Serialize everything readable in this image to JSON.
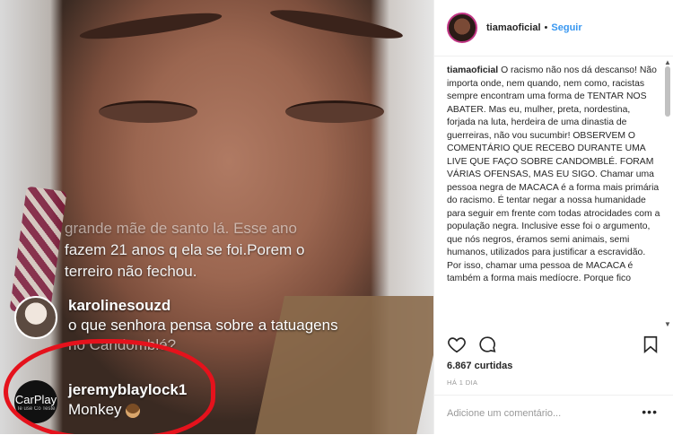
{
  "live": {
    "overlay_lines": [
      "grande mãe de santo lá. Esse ano",
      "fazem 21 anos q ela se foi.Porem o",
      "terreiro não fechou."
    ],
    "comments": [
      {
        "username": "karolinesouzd",
        "text_lines": [
          "o que senhora pensa sobre a tatuagens",
          "no Candomblé?"
        ]
      },
      {
        "username": "jeremyblaylock1",
        "text_lines": [
          "Monkey"
        ],
        "avatar_text": "CarPlay",
        "avatar_subtext": "Te use Co Teste"
      }
    ],
    "highlight_color": "#e5121c"
  },
  "post": {
    "username": "tiamaoficial",
    "separator": "•",
    "follow_label": "Seguir",
    "caption": "O racismo não nos dá descanso! Não importa onde, nem quando, nem como, racistas sempre encontram uma forma de TENTAR NOS ABATER. Mas eu, mulher, preta, nordestina, forjada na luta, herdeira de uma dinastia de guerreiras, não vou sucumbir! OBSERVEM O COMENTÁRIO QUE RECEBO DURANTE UMA LIVE QUE FAÇO SOBRE CANDOMBLÉ. FORAM VÁRIAS OFENSAS, MAS EU SIGO. Chamar uma pessoa negra de MACACA é a forma mais primária do racismo. É tentar negar a nossa humanidade para seguir em frente com todas atrocidades com a população negra. Inclusive esse foi o argumento, que nós negros, éramos semi animais, semi humanos, utilizados para justificar a escravidão. Por isso, chamar uma pessoa de MACACA é também a forma mais medíocre. Porque fico",
    "likes": "6.867 curtidas",
    "time": "HÁ 1 DIA",
    "add_comment_placeholder": "Adicione um comentário...",
    "more_label": "•••",
    "follow_color": "#3897f0",
    "icons": [
      "heart-icon",
      "comment-icon",
      "bookmark-icon"
    ]
  }
}
